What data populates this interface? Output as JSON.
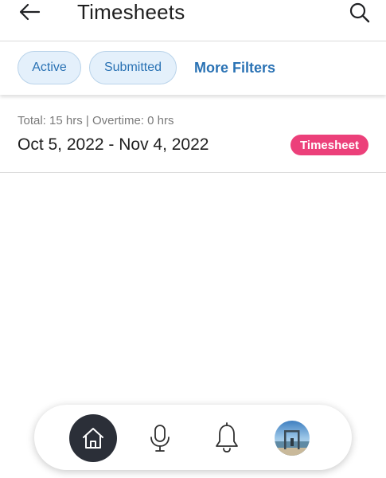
{
  "header": {
    "title": "Timesheets",
    "back_icon": "arrow-left-icon",
    "search_icon": "search-icon"
  },
  "filters": {
    "chips": [
      {
        "label": "Active"
      },
      {
        "label": "Submitted"
      }
    ],
    "more_label": "More Filters"
  },
  "timesheet": {
    "summary": "Total: 15 hrs | Overtime: 0 hrs",
    "date_range": "Oct 5, 2022 - Nov 4, 2022",
    "badge": "Timesheet"
  },
  "bottom_nav": {
    "items": [
      {
        "icon": "home-icon",
        "active": true
      },
      {
        "icon": "microphone-icon",
        "active": false
      },
      {
        "icon": "bell-icon",
        "active": false
      },
      {
        "icon": "avatar",
        "active": false
      }
    ]
  },
  "colors": {
    "accent": "#2a72b4",
    "chip_bg": "#e4f0fb",
    "badge": "#ec407a",
    "nav_active": "#2b2f38"
  }
}
